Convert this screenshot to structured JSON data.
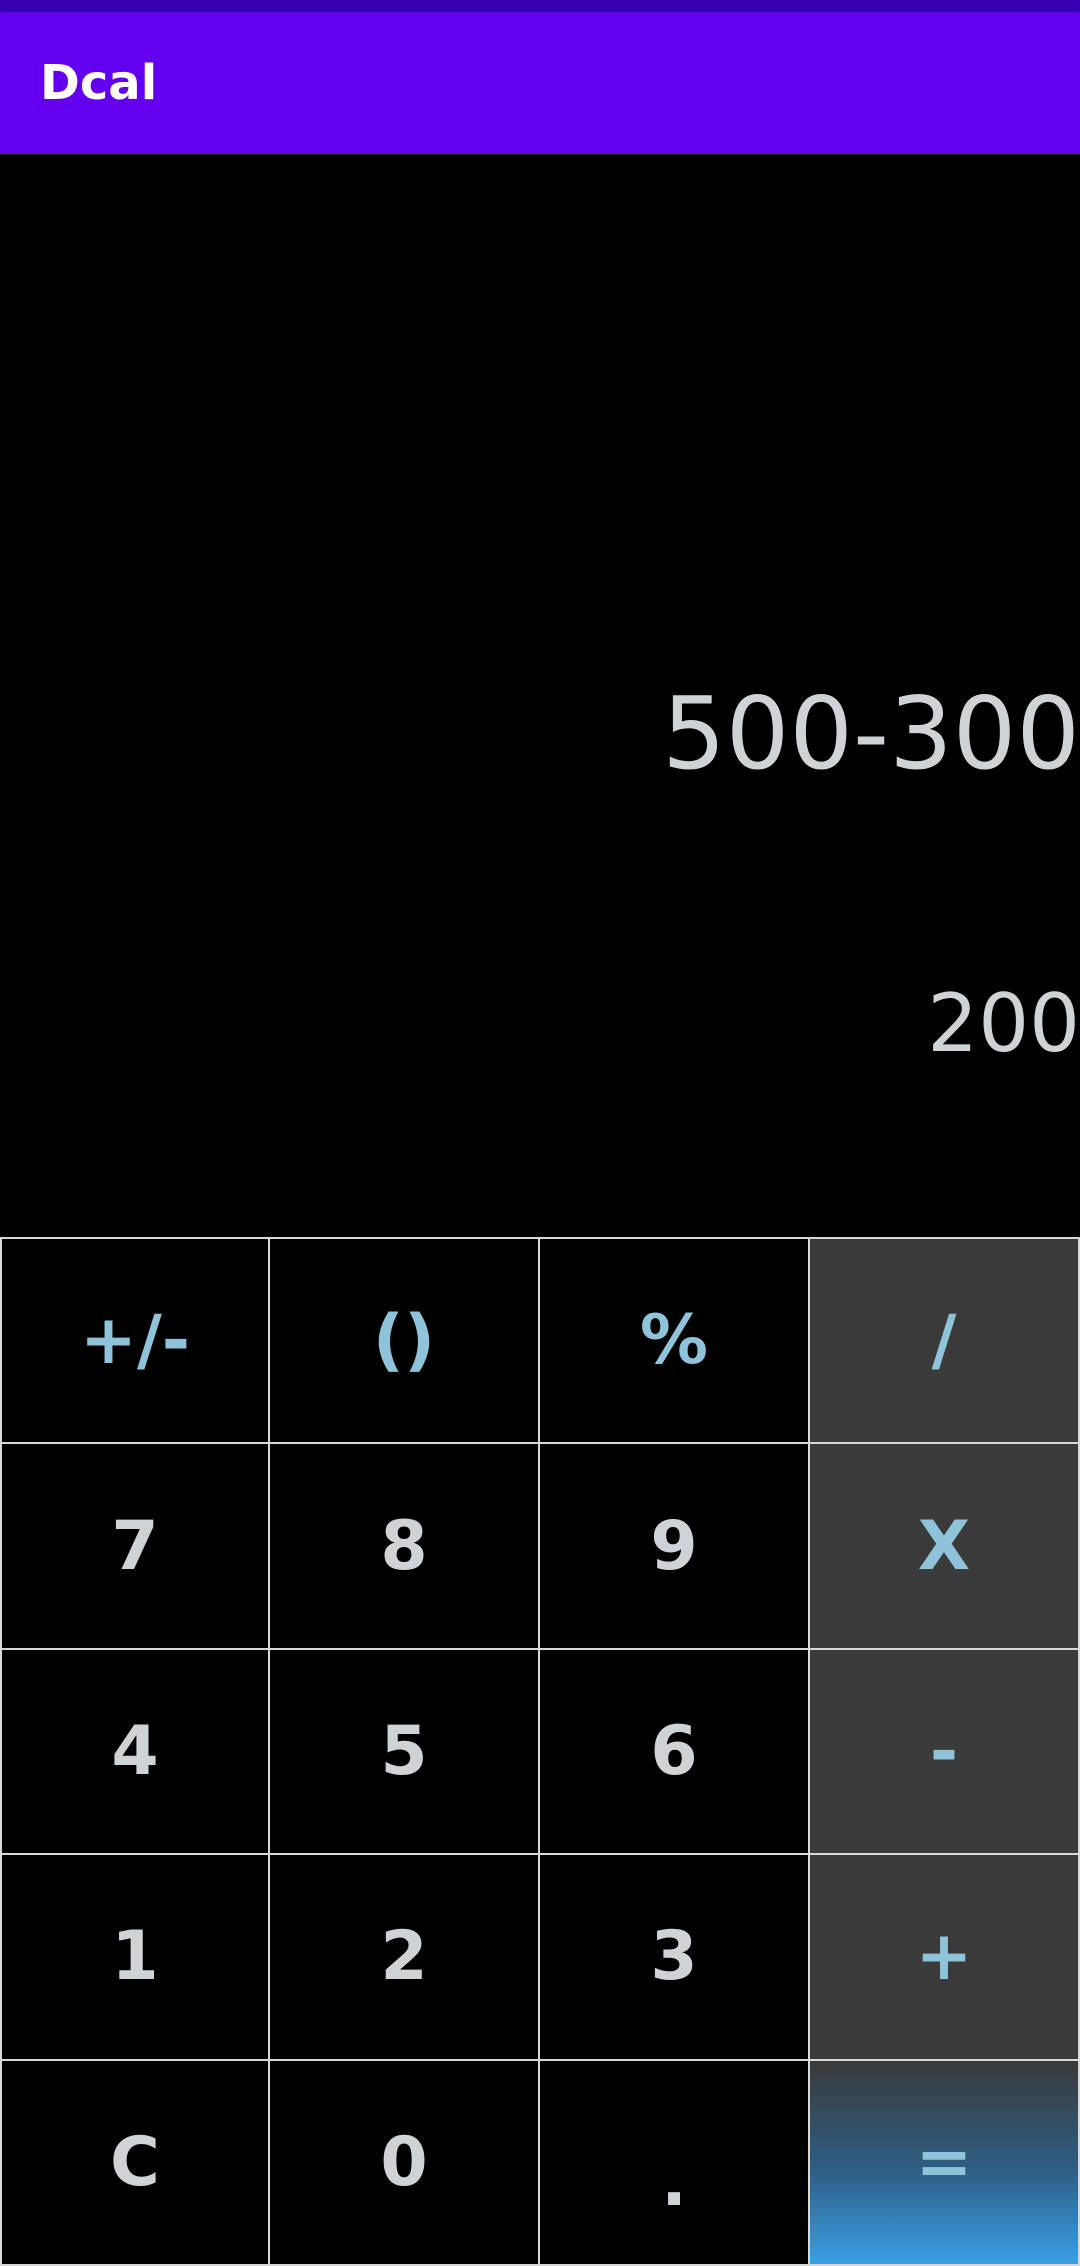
{
  "app": {
    "title": "Dcal"
  },
  "display": {
    "expression": "500-300",
    "result": "200"
  },
  "keypad": {
    "row1": [
      "+/-",
      "()",
      "%",
      "/"
    ],
    "row2": [
      "7",
      "8",
      "9",
      "X"
    ],
    "row3": [
      "4",
      "5",
      "6",
      "-"
    ],
    "row4": [
      "1",
      "2",
      "3",
      "+"
    ],
    "row5": [
      "C",
      "0",
      ".",
      "="
    ]
  },
  "colors": {
    "status_bar": "#3700b3",
    "app_bar": "#6200ee",
    "operator_text": "#8fc3d9",
    "operator_bg": "#3a3a3a",
    "digit_text": "#cfd3d6",
    "equals_accent": "#3aa0e6"
  }
}
